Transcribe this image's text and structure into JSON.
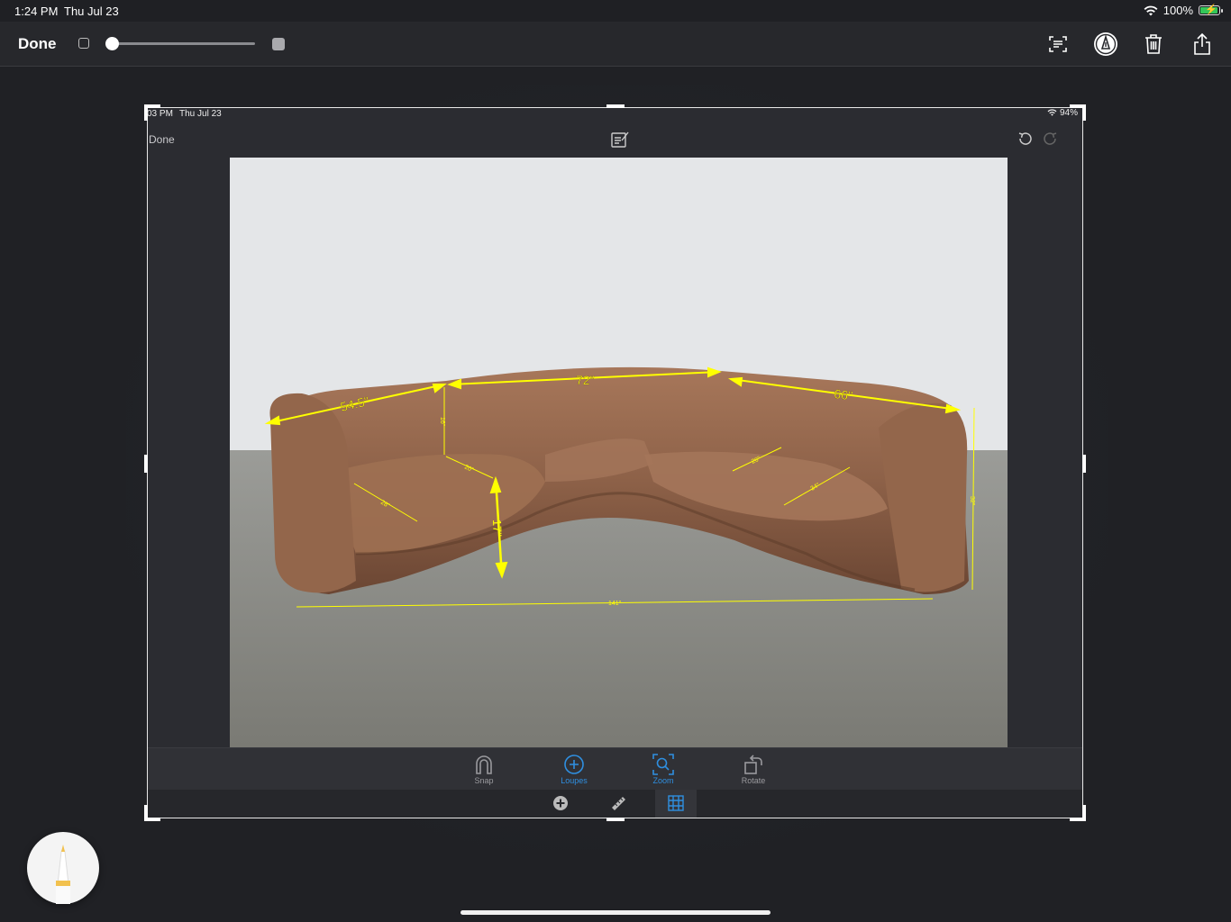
{
  "status_bar": {
    "time": "1:24 PM",
    "date": "Thu Jul 23",
    "battery": "100%",
    "battery_level": 1.0
  },
  "toolbar": {
    "done_label": "Done",
    "line_width_slider": 0.0,
    "icons": [
      "text-recognition-icon",
      "markup-pen-icon",
      "trash-icon",
      "share-icon"
    ]
  },
  "screenshot": {
    "status": {
      "time": "03 PM",
      "date": "Thu Jul 23",
      "battery": "94%"
    },
    "done_label": "Done",
    "measurements": {
      "back_left": "54.5\"",
      "back_center": "72\"",
      "back_right": "66\"",
      "seat_height": "17\"",
      "left_small_1": "16\"",
      "left_small_2": "20\"",
      "left_small_3": "28\"",
      "right_small_1": "26\"",
      "right_small_2": "34\"",
      "overall_height": "32\"",
      "overall_width": "141\""
    },
    "tabs": [
      {
        "label": "Snap",
        "icon": "magnet-icon",
        "active": false
      },
      {
        "label": "Loupes",
        "icon": "loupe-icon",
        "active": true
      },
      {
        "label": "Zoom",
        "icon": "zoom-icon",
        "active": true
      },
      {
        "label": "Rotate",
        "icon": "rotate-icon",
        "active": false
      }
    ],
    "sub_tools": [
      "add-icon",
      "ruler-icon",
      "grid-icon"
    ],
    "colors": {
      "accent": "#2f8fe0",
      "annotation": "#ffff00",
      "sofa": "#9a6b4b"
    }
  }
}
